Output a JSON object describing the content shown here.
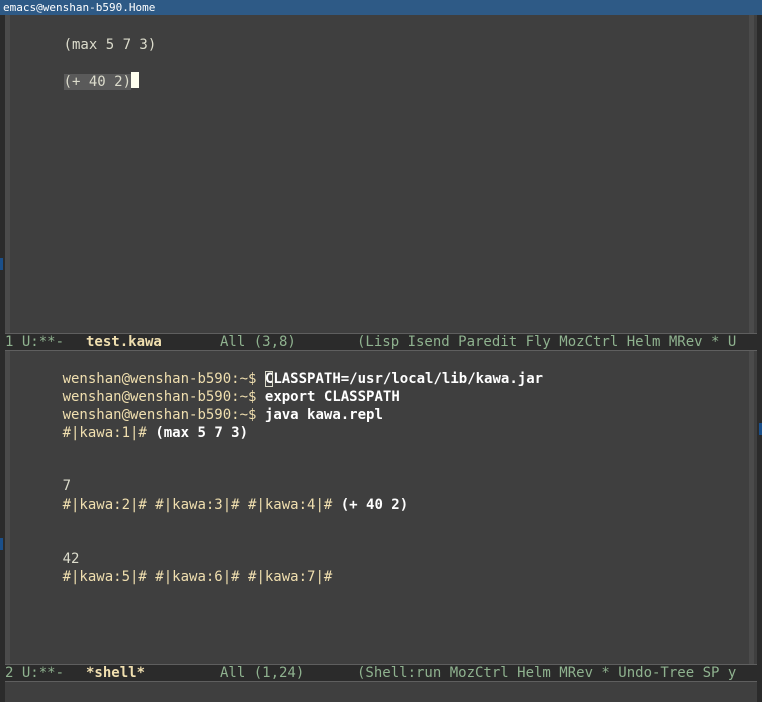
{
  "titlebar": {
    "title": "emacs@wenshan-b590.Home"
  },
  "top_window": {
    "lines": {
      "max_expr": "(max 5 7 3)",
      "plus_expr": "(+ 40 2)"
    }
  },
  "top_modeline": {
    "state": "1 U:**-",
    "buffer": "test.kawa",
    "position": "All (3,8)",
    "modes": "(Lisp Isend Paredit Fly MozCtrl Helm MRev * U"
  },
  "shell": {
    "prompt": "wenshan@wenshan-b590:~$",
    "cmd1_first": "C",
    "cmd1_rest": "LASSPATH=/usr/local/lib/kawa.jar",
    "cmd2": "export CLASSPATH",
    "cmd3": "java kawa.repl",
    "repl1_prompt": "#|kawa:1|#",
    "repl1_input": "(max 5 7 3)",
    "out1": "7",
    "repl2_prompts": "#|kawa:2|# #|kawa:3|# #|kawa:4|#",
    "repl2_input": "(+ 40 2)",
    "out2": "42",
    "repl3_prompts": "#|kawa:5|# #|kawa:6|# #|kawa:7|#"
  },
  "bottom_modeline": {
    "state": "2 U:**-",
    "buffer": "*shell*",
    "position": "All (1,24)",
    "modes": "(Shell:run MozCtrl Helm MRev * Undo-Tree SP y"
  },
  "colors": {
    "background": "#3f3f3f",
    "foreground": "#dcdccc",
    "modeline_bg": "#2b2b2b",
    "modeline_fg": "#8fb28f",
    "buffer_name": "#f0dfaf",
    "titlebar": "#2e5a86"
  }
}
